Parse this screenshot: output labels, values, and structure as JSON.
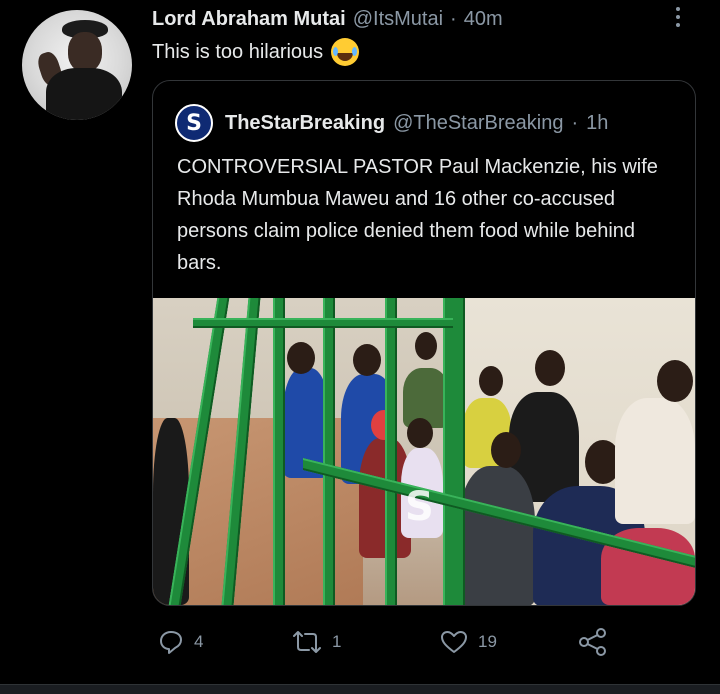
{
  "tweet": {
    "author_name": "Lord Abraham Mutai",
    "author_handle": "@ItsMutai",
    "separator": "·",
    "time": "40m",
    "text": "This is too hilarious",
    "emoji": "face-with-tears-of-joy"
  },
  "quoted_tweet": {
    "author_name": "TheStarBreaking",
    "author_handle": "@TheStarBreaking",
    "separator": "·",
    "time": "1h",
    "text": "CONTROVERSIAL PASTOR Paul Mackenzie, his wife Rhoda Mumbua Maweu and 16 other co-accused persons claim police denied them food while behind bars.",
    "avatar_letter": "S",
    "watermark_letter": "S"
  },
  "actions": {
    "replies": "4",
    "retweets": "1",
    "likes": "19"
  },
  "colors": {
    "background": "#000000",
    "text": "#e7e9ea",
    "secondary": "#8b98a5",
    "border": "#333639",
    "bars": "#1e8a3a"
  },
  "icons": [
    "more-icon",
    "reply-icon",
    "retweet-icon",
    "like-icon",
    "share-icon"
  ]
}
